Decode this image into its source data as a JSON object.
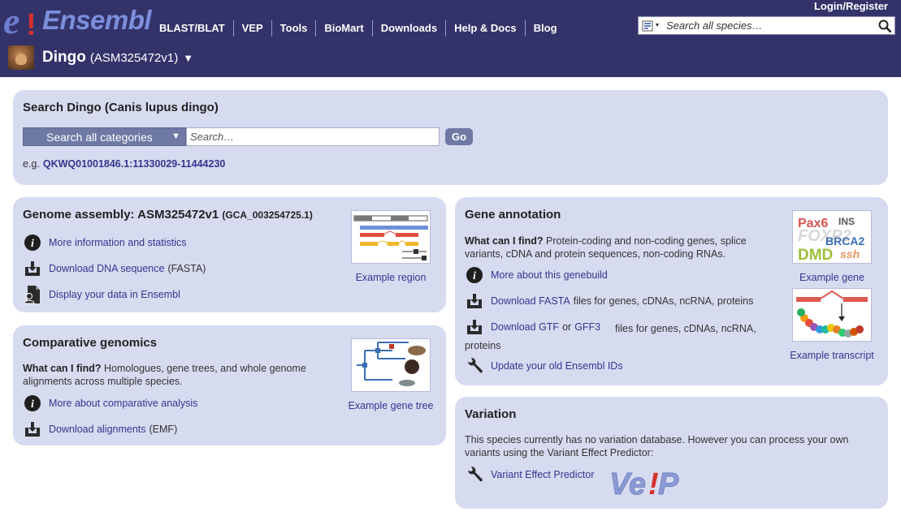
{
  "header": {
    "logo_text": "Ensembl",
    "login": "Login/Register",
    "nav": [
      "BLAST/BLAT",
      "VEP",
      "Tools",
      "BioMart",
      "Downloads",
      "Help & Docs",
      "Blog"
    ],
    "site_search_placeholder": "Search all species…",
    "species_name": "Dingo",
    "species_assembly": "(ASM325472v1)",
    "species_caret": "▼"
  },
  "search": {
    "title": "Search Dingo (Canis lupus dingo)",
    "category": "Search all categories",
    "placeholder": "Search…",
    "go": "Go",
    "example_prefix": "e.g.",
    "example_link": "QKWQ01001846.1:11330029-11444230"
  },
  "genome": {
    "title": "Genome assembly: ASM325472v1",
    "accession": "(GCA_003254725.1)",
    "more_info": "More information and statistics",
    "download_dna": "Download DNA sequence",
    "download_dna_suffix": "(FASTA)",
    "display_data": "Display your data in Ensembl",
    "example": "Example region"
  },
  "comparative": {
    "title": "Comparative genomics",
    "what_label": "What can I find?",
    "what_text": "Homologues, gene trees, and whole genome alignments across multiple species.",
    "more_about": "More about comparative analysis",
    "download": "Download alignments",
    "download_suffix": "(EMF)",
    "example": "Example gene tree"
  },
  "gene": {
    "title": "Gene annotation",
    "what_label": "What can I find?",
    "what_text": "Protein-coding and non-coding genes, splice variants, cDNA and protein sequences, non-coding RNAs.",
    "more_about": "More about this genebuild",
    "download_fasta": "Download FASTA",
    "download_fasta_suffix": "files for genes, cDNAs, ncRNA, proteins",
    "download_gtf": "Download GTF",
    "or": "or",
    "gff3": "GFF3",
    "download_gtf_suffix": "files for genes, cDNAs, ncRNA, proteins",
    "update_ids": "Update your old Ensembl IDs",
    "example_gene": "Example gene",
    "example_transcript": "Example transcript",
    "gene_words": [
      "Pax6",
      "INS",
      "FOXP2",
      "BRCA2",
      "DMD",
      "ssh"
    ]
  },
  "variation": {
    "title": "Variation",
    "text": "This species currently has no variation database. However you can process your own variants using the Variant Effect Predictor:",
    "vep_link": "Variant Effect Predictor",
    "vep_logo": "Ve!P"
  },
  "colors": {
    "masthead": "#33336a",
    "panel": "#d7dbf0",
    "link": "#33368f",
    "button": "#6e7aa4"
  }
}
